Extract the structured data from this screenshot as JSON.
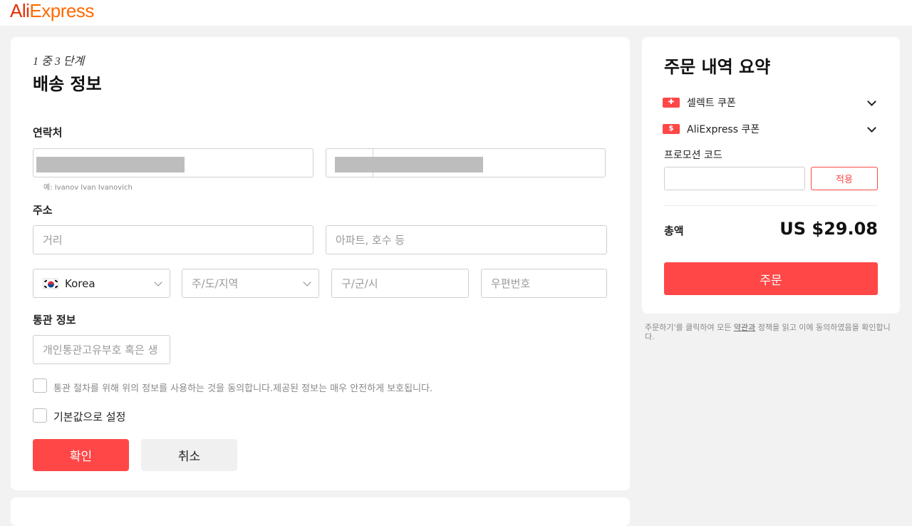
{
  "brand": {
    "logo_part1": "Ali",
    "logo_part2": "Express"
  },
  "shipping": {
    "step": "1 중 3 단계",
    "title": "배송 정보",
    "contact_label": "연락처",
    "name_hint": "예: Ivanov Ivan Ivanovich",
    "address_label": "주소",
    "street_placeholder": "거리",
    "apt_placeholder": "아파트, 호수 등",
    "country": "Korea",
    "province_placeholder": "주/도/지역",
    "city_placeholder": "구/군/시",
    "zip_placeholder": "우편번호",
    "customs_label": "통관 정보",
    "customs_placeholder": "개인통관고유부호 혹은 생",
    "consent_text": "통관 절차를 위해 위의 정보를 사용하는 것을 동의합니다.제공된 정보는 매우 안전하게 보호됩니다.",
    "default_text": "기본값으로 설정",
    "confirm_label": "확인",
    "cancel_label": "취소"
  },
  "summary": {
    "title": "주문 내역 요약",
    "select_coupon": "셀렉트 쿠폰",
    "aliexpress_coupon": "AliExpress 쿠폰",
    "promo_label": "프로모션 코드",
    "apply_label": "적용",
    "total_label": "총액",
    "total_value": "US $29.08",
    "order_label": "주문",
    "terms_before": "주문하기'를 클릭하여 모든 ",
    "terms_link": "약관과",
    "terms_after": " 정책을 읽고 이에 동의하였음을 확인합니다."
  },
  "colors": {
    "accent": "#ff4747",
    "logo_red": "#e62e04",
    "logo_orange": "#ff6a00"
  }
}
